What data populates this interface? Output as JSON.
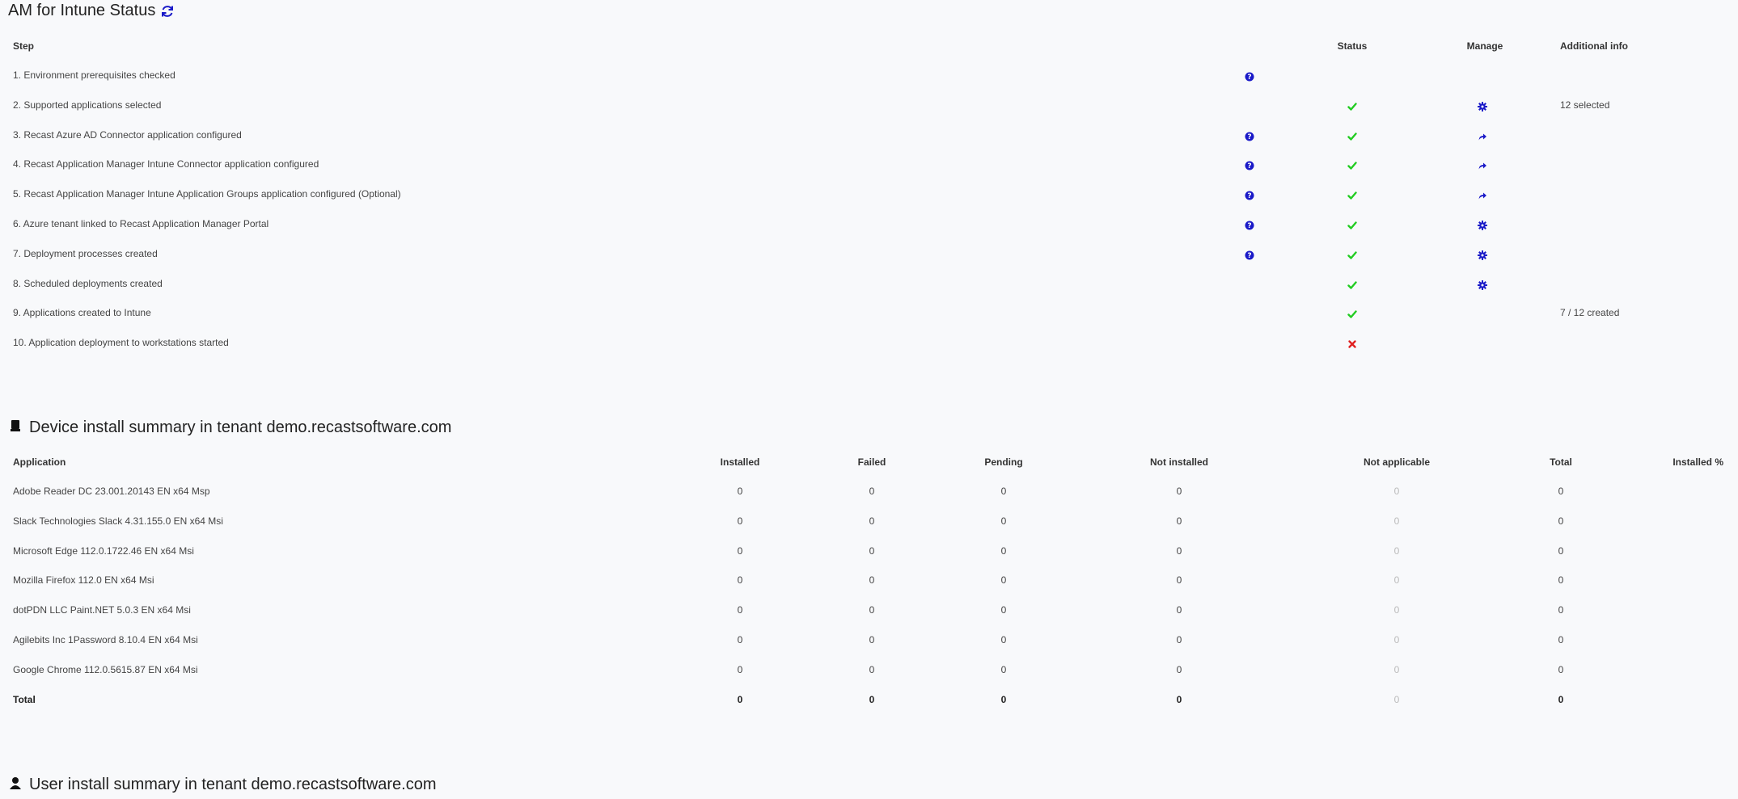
{
  "status_title": "AM for Intune Status",
  "status_table": {
    "headers": {
      "step": "Step",
      "status": "Status",
      "manage": "Manage",
      "info": "Additional info"
    },
    "rows": [
      {
        "label": "1. Environment prerequisites checked",
        "help": true,
        "status": "",
        "manage": "",
        "info": ""
      },
      {
        "label": "2. Supported applications selected",
        "help": false,
        "status": "ok",
        "manage": "gear",
        "info": "12 selected"
      },
      {
        "label": "3. Recast Azure AD Connector application configured",
        "help": true,
        "status": "ok",
        "manage": "share",
        "info": ""
      },
      {
        "label": "4. Recast Application Manager Intune Connector application configured",
        "help": true,
        "status": "ok",
        "manage": "share",
        "info": ""
      },
      {
        "label": "5. Recast Application Manager Intune Application Groups application configured (Optional)",
        "help": true,
        "status": "ok",
        "manage": "share",
        "info": ""
      },
      {
        "label": "6. Azure tenant linked to Recast Application Manager Portal",
        "help": true,
        "status": "ok",
        "manage": "gear",
        "info": ""
      },
      {
        "label": "7. Deployment processes created",
        "help": true,
        "status": "ok",
        "manage": "gear",
        "info": ""
      },
      {
        "label": "8. Scheduled deployments created",
        "help": false,
        "status": "ok",
        "manage": "gear",
        "info": ""
      },
      {
        "label": "9. Applications created to Intune",
        "help": false,
        "status": "ok",
        "manage": "",
        "info": "7 / 12 created"
      },
      {
        "label": "10. Application deployment to workstations started",
        "help": false,
        "status": "fail",
        "manage": "",
        "info": ""
      }
    ]
  },
  "device_summary": {
    "title": "Device install summary in tenant demo.recastsoftware.com",
    "headers": [
      "Application",
      "Installed",
      "Failed",
      "Pending",
      "Not installed",
      "Not applicable",
      "Total",
      "Installed %"
    ],
    "rows": [
      {
        "app": "Adobe Reader DC 23.001.20143 EN x64 Msp",
        "installed": "0",
        "failed": "0",
        "pending": "0",
        "not_installed": "0",
        "not_applicable": "0",
        "total": "0",
        "pct": ""
      },
      {
        "app": "Slack Technologies Slack 4.31.155.0 EN x64 Msi",
        "installed": "0",
        "failed": "0",
        "pending": "0",
        "not_installed": "0",
        "not_applicable": "0",
        "total": "0",
        "pct": ""
      },
      {
        "app": "Microsoft Edge 112.0.1722.46 EN x64 Msi",
        "installed": "0",
        "failed": "0",
        "pending": "0",
        "not_installed": "0",
        "not_applicable": "0",
        "total": "0",
        "pct": ""
      },
      {
        "app": "Mozilla Firefox 112.0 EN x64 Msi",
        "installed": "0",
        "failed": "0",
        "pending": "0",
        "not_installed": "0",
        "not_applicable": "0",
        "total": "0",
        "pct": ""
      },
      {
        "app": "dotPDN LLC Paint.NET 5.0.3 EN x64 Msi",
        "installed": "0",
        "failed": "0",
        "pending": "0",
        "not_installed": "0",
        "not_applicable": "0",
        "total": "0",
        "pct": ""
      },
      {
        "app": "Agilebits Inc 1Password 8.10.4 EN x64 Msi",
        "installed": "0",
        "failed": "0",
        "pending": "0",
        "not_installed": "0",
        "not_applicable": "0",
        "total": "0",
        "pct": ""
      },
      {
        "app": "Google Chrome 112.0.5615.87 EN x64 Msi",
        "installed": "0",
        "failed": "0",
        "pending": "0",
        "not_installed": "0",
        "not_applicable": "0",
        "total": "0",
        "pct": ""
      }
    ],
    "total": {
      "app": "Total",
      "installed": "0",
      "failed": "0",
      "pending": "0",
      "not_installed": "0",
      "not_applicable": "0",
      "total": "0",
      "pct": ""
    }
  },
  "user_summary": {
    "title": "User install summary in tenant demo.recastsoftware.com"
  },
  "icons": {
    "refresh": "refresh-icon",
    "help": "question-circle-icon",
    "ok": "check-icon",
    "fail": "cross-icon",
    "gear": "gear-icon",
    "share": "share-arrow-icon",
    "device": "device-icon",
    "user": "user-icon"
  },
  "colors": {
    "blue": "#1a1ac8",
    "green": "#22cc22",
    "red": "#e02020",
    "muted": "#bbbbbb"
  }
}
